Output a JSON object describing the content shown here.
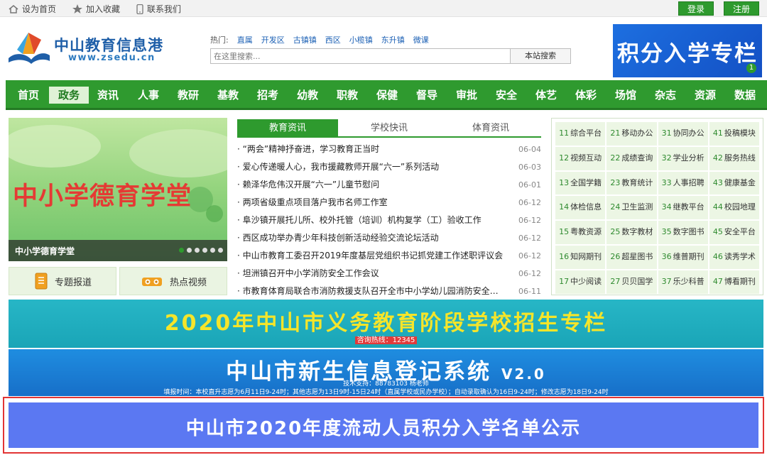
{
  "topbar": {
    "set_home": "设为首页",
    "add_favorite": "加入收藏",
    "contact_us": "联系我们",
    "login": "登录",
    "register": "注册"
  },
  "logo": {
    "name": "中山教育信息港",
    "url": "www.zsedu.cn"
  },
  "hot": {
    "label": "热门:",
    "links": [
      "直属",
      "开发区",
      "古镇镇",
      "西区",
      "小榄镇",
      "东升镇",
      "微课"
    ]
  },
  "search": {
    "placeholder": "在这里搜索...",
    "button": "本站搜索"
  },
  "promo_top": {
    "text": "积分入学专栏",
    "badge": "1"
  },
  "nav": [
    "首页",
    "政务",
    "资讯",
    "人事",
    "教研",
    "基教",
    "招考",
    "幼教",
    "职教",
    "保健",
    "督导",
    "审批",
    "安全",
    "体艺",
    "体彩",
    "场馆",
    "杂志",
    "资源",
    "数据"
  ],
  "nav_active": "政务",
  "banner": {
    "text": "中小学德育学堂",
    "caption": "中小学德育学堂",
    "slide_count": 6,
    "active_slide": 1
  },
  "sub_buttons": {
    "special": "专题报道",
    "video": "热点视频"
  },
  "news_tabs": [
    "教育资讯",
    "学校快讯",
    "体育资讯"
  ],
  "news": [
    {
      "title": "“两会”精神抒奋进，学习教育正当时",
      "date": "06-04"
    },
    {
      "title": "爱心传递暖人心，我市援藏教师开展“六一”系列活动",
      "date": "06-03"
    },
    {
      "title": "赖泽华危伟汉开展“六一”儿童节慰问",
      "date": "06-01"
    },
    {
      "title": "两项省级重点项目落户我市名师工作室",
      "date": "06-12"
    },
    {
      "title": "阜沙镇开展托儿所、校外托管（培训）机构复学（工）验收工作",
      "date": "06-12"
    },
    {
      "title": "西区成功举办青少年科技创新活动经验交流论坛活动",
      "date": "06-12"
    },
    {
      "title": "中山市教育工委召开2019年度基层党组织书记抓党建工作述职评议会",
      "date": "06-12"
    },
    {
      "title": "坦洲镇召开中小学消防安全工作会议",
      "date": "06-12"
    },
    {
      "title": "市教育体育局联合市消防救援支队召开全市中小学幼儿园消防安全…",
      "date": "06-11"
    }
  ],
  "grid": [
    [
      {
        "n": "11",
        "t": "综合平台"
      },
      {
        "n": "21",
        "t": "移动办公"
      },
      {
        "n": "31",
        "t": "协同办公"
      },
      {
        "n": "41",
        "t": "投稿模块"
      }
    ],
    [
      {
        "n": "12",
        "t": "视频互动"
      },
      {
        "n": "22",
        "t": "成绩查询"
      },
      {
        "n": "32",
        "t": "学业分析"
      },
      {
        "n": "42",
        "t": "服务热线"
      }
    ],
    [
      {
        "n": "13",
        "t": "全国学籍"
      },
      {
        "n": "23",
        "t": "教育统计"
      },
      {
        "n": "33",
        "t": "人事招聘"
      },
      {
        "n": "43",
        "t": "健康基金"
      }
    ],
    [
      {
        "n": "14",
        "t": "体检信息"
      },
      {
        "n": "24",
        "t": "卫生监测"
      },
      {
        "n": "34",
        "t": "继教平台"
      },
      {
        "n": "44",
        "t": "校园地理"
      }
    ],
    [
      {
        "n": "15",
        "t": "粤教资源"
      },
      {
        "n": "25",
        "t": "数字教材"
      },
      {
        "n": "35",
        "t": "数字图书"
      },
      {
        "n": "45",
        "t": "安全平台"
      }
    ],
    [
      {
        "n": "16",
        "t": "知网期刊"
      },
      {
        "n": "26",
        "t": "超星图书"
      },
      {
        "n": "36",
        "t": "维普期刊"
      },
      {
        "n": "46",
        "t": "读秀学术"
      }
    ],
    [
      {
        "n": "17",
        "t": "中少阅读"
      },
      {
        "n": "27",
        "t": "贝贝国学"
      },
      {
        "n": "37",
        "t": "乐少科普"
      },
      {
        "n": "47",
        "t": "博看期刊"
      }
    ]
  ],
  "banner_enroll": {
    "title": "2020年中山市义务教育阶段学校招生专栏",
    "hotline": "咨询热线：12345"
  },
  "banner_register": {
    "title": "中山市新生信息登记系统",
    "version": "V2.0",
    "support": "技术支持：88783103 杨老师",
    "notice": "填报时间：本校直升志愿为6月11日9-24时；其他志愿为13日9时-15日24时（直属学校或民办学校）；自动录取确认为16日9-24时；修改志愿为18日9-24时"
  },
  "banner_points": {
    "title": "中山市2020年度流动人员积分入学名单公示"
  },
  "colors": {
    "brand_green": "#2e9a2e",
    "nav_green": "#2f9a2f",
    "promo_blue": "#1d6fe0",
    "enroll_cyan": "#1aa5b7",
    "enroll_yellow": "#f5e52a",
    "register_blue": "#1f8de0",
    "points_blue": "#5b78f2",
    "highlight_red": "#e23434"
  }
}
